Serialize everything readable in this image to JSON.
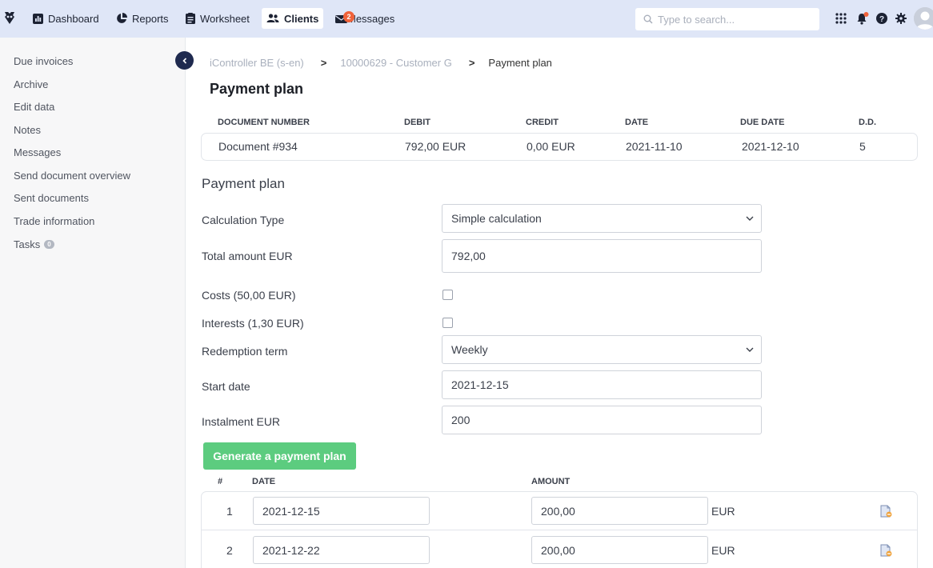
{
  "nav": {
    "items": [
      {
        "label": "Dashboard",
        "icon": "bar-chart-icon"
      },
      {
        "label": "Reports",
        "icon": "pie-chart-icon"
      },
      {
        "label": "Worksheet",
        "icon": "clipboard-icon"
      },
      {
        "label": "Clients",
        "icon": "users-icon",
        "active": true
      },
      {
        "label": "Messages",
        "icon": "envelope-icon",
        "badge": "2"
      }
    ],
    "search_placeholder": "Type to search..."
  },
  "sidebar": {
    "items": [
      {
        "label": "Due invoices"
      },
      {
        "label": "Archive"
      },
      {
        "label": "Edit data"
      },
      {
        "label": "Notes"
      },
      {
        "label": "Messages"
      },
      {
        "label": "Send document overview"
      },
      {
        "label": "Sent documents"
      },
      {
        "label": "Trade information"
      },
      {
        "label": "Tasks",
        "badge": "0"
      }
    ]
  },
  "breadcrumb": {
    "items": [
      "iController BE (s-en)",
      "10000629 - Customer G",
      "Payment plan"
    ],
    "separator": ">"
  },
  "page_title": "Payment plan",
  "document_table": {
    "headers": [
      "DOCUMENT NUMBER",
      "DEBIT",
      "CREDIT",
      "DATE",
      "DUE DATE",
      "D.D."
    ],
    "row": [
      "Document #934",
      "792,00 EUR",
      "0,00 EUR",
      "2021-11-10",
      "2021-12-10",
      "5"
    ]
  },
  "form": {
    "section_title": "Payment plan",
    "calculation_type_label": "Calculation Type",
    "calculation_type_value": "Simple calculation",
    "total_amount_label": "Total amount EUR",
    "total_amount_value": "792,00",
    "costs_label": "Costs (50,00 EUR)",
    "costs_checked": false,
    "interests_label": "Interests (1,30 EUR)",
    "interests_checked": false,
    "redemption_term_label": "Redemption term",
    "redemption_term_value": "Weekly",
    "start_date_label": "Start date",
    "start_date_value": "2021-12-15",
    "instalment_label": "Instalment EUR",
    "instalment_value": "200",
    "generate_button": "Generate a payment plan"
  },
  "plan_table": {
    "headers": [
      "#",
      "DATE",
      "AMOUNT"
    ],
    "rows": [
      {
        "num": "1",
        "date": "2021-12-15",
        "amount": "200,00",
        "currency": "EUR"
      },
      {
        "num": "2",
        "date": "2021-12-22",
        "amount": "200,00",
        "currency": "EUR"
      }
    ]
  },
  "colors": {
    "topbar": "#dfe6f7",
    "accent_navy": "#1f2a4f",
    "green_button": "#5ccc7f",
    "badge_orange": "#f0623a"
  }
}
